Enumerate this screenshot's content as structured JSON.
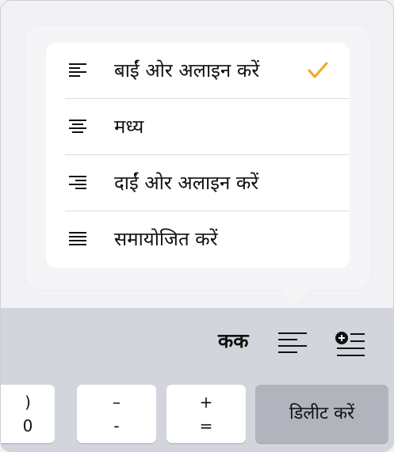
{
  "alignment_menu": {
    "items": [
      {
        "label": "बाईं ओर अलाइन करें",
        "icon": "align-left-icon",
        "selected": true
      },
      {
        "label": "मध्य",
        "icon": "align-center-icon",
        "selected": false
      },
      {
        "label": "दाईं ओर अलाइन करें",
        "icon": "align-right-icon",
        "selected": false
      },
      {
        "label": "समायोजित करें",
        "icon": "align-justify-icon",
        "selected": false
      }
    ],
    "check_color": "#f5a623"
  },
  "toolbar": {
    "text_style_label": "कक",
    "align_icon": "align-left-icon",
    "insert_icon": "insert-list-icon"
  },
  "keyboard": {
    "keys": [
      {
        "top": ")",
        "bottom": "0"
      },
      {
        "top": "–",
        "bottom": "-"
      },
      {
        "top": "+",
        "bottom": "="
      }
    ],
    "delete_label": "डिलीट करें"
  }
}
